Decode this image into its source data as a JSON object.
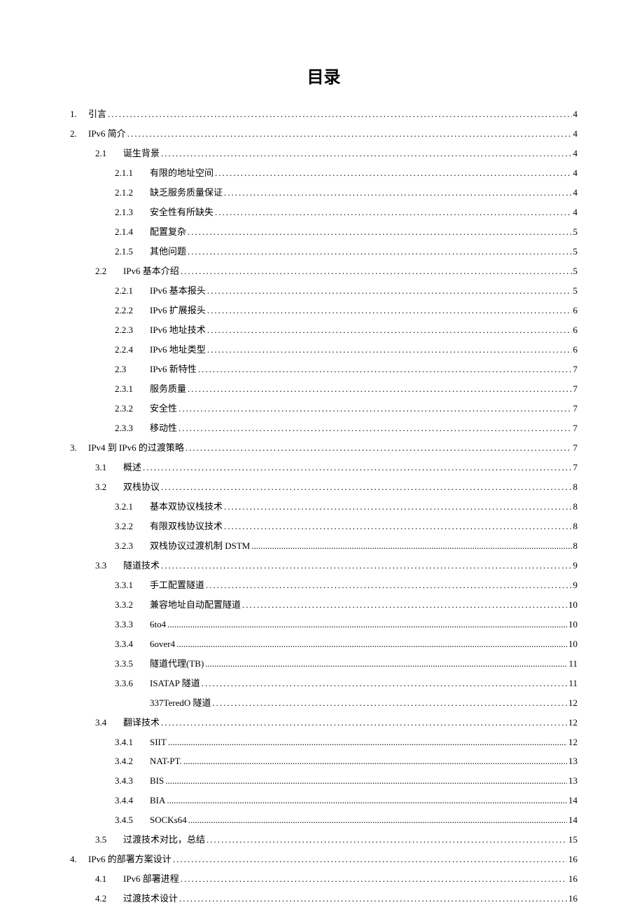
{
  "title": "目录",
  "entries": [
    {
      "level": 0,
      "num": "1.",
      "label": "引言",
      "page": "4",
      "dotStyle": "dots"
    },
    {
      "level": 0,
      "num": "2.",
      "label": "IPv6 简介",
      "page": "4",
      "dotStyle": "dots"
    },
    {
      "level": 1,
      "num": "2.1",
      "label": "诞生背景",
      "page": "4",
      "dotStyle": "dots"
    },
    {
      "level": 2,
      "num": "2.1.1",
      "label": "有限的地址空间",
      "page": "4",
      "dotStyle": "dots"
    },
    {
      "level": 2,
      "num": "2.1.2",
      "label": "缺乏服务质量保证",
      "page": "4",
      "dotStyle": "dots"
    },
    {
      "level": 2,
      "num": "2.1.3",
      "label": "安全性有所缺失",
      "page": "4",
      "dotStyle": "dots"
    },
    {
      "level": 2,
      "num": "2.1.4",
      "label": "配置复杂",
      "page": "5",
      "dotStyle": "dots"
    },
    {
      "level": 2,
      "num": "2.1.5",
      "label": "其他问题",
      "page": "5",
      "dotStyle": "dots"
    },
    {
      "level": 1,
      "num": "2.2",
      "label": "IPv6 基本介绍",
      "page": "5",
      "dotStyle": "dots"
    },
    {
      "level": 2,
      "num": "2.2.1",
      "label": "IPv6 基本报头",
      "page": "5",
      "dotStyle": "dots"
    },
    {
      "level": 2,
      "num": "2.2.2",
      "label": "IPv6 扩展报头",
      "page": "6",
      "dotStyle": "dots"
    },
    {
      "level": 2,
      "num": "2.2.3",
      "label": "IPv6 地址技术",
      "page": "6",
      "dotStyle": "dots"
    },
    {
      "level": 2,
      "num": "2.2.4",
      "label": "IPv6 地址类型",
      "page": "6",
      "dotStyle": "dots"
    },
    {
      "level": 2,
      "num": "2.3",
      "label": "IPv6 新特性",
      "page": "7",
      "dotStyle": "dots"
    },
    {
      "level": 2,
      "num": "2.3.1",
      "label": "服务质量",
      "page": "7",
      "dotStyle": "dots"
    },
    {
      "level": 2,
      "num": "2.3.2",
      "label": "安全性",
      "page": "7",
      "dotStyle": "dots"
    },
    {
      "level": 2,
      "num": "2.3.3",
      "label": "移动性",
      "page": "7",
      "dotStyle": "dots"
    },
    {
      "level": 0,
      "num": "3.",
      "label": "IPv4 到 IPv6 的过渡策略",
      "page": "7",
      "dotStyle": "dots"
    },
    {
      "level": 1,
      "num": "3.1",
      "label": "概述",
      "page": "7",
      "dotStyle": "dots"
    },
    {
      "level": 1,
      "num": "3.2",
      "label": "双栈协议",
      "page": "8",
      "dotStyle": "dots"
    },
    {
      "level": 2,
      "num": "3.2.1",
      "label": "基本双协议栈技术",
      "page": "8",
      "dotStyle": "dots"
    },
    {
      "level": 2,
      "num": "3.2.2",
      "label": "有限双栈协议技术",
      "page": "8",
      "dotStyle": "dots"
    },
    {
      "level": 2,
      "num": "3.2.3",
      "label": "双栈协议过渡机制 DSTM",
      "page": "8",
      "dotStyle": "dots-tight"
    },
    {
      "level": 1,
      "num": "3.3",
      "label": "隧道技术",
      "page": "9",
      "dotStyle": "dots"
    },
    {
      "level": 2,
      "num": "3.3.1",
      "label": "手工配置隧道",
      "page": "9",
      "dotStyle": "dots"
    },
    {
      "level": 2,
      "num": "3.3.2",
      "label": "兼容地址自动配置隧道",
      "page": "10",
      "dotStyle": "dots"
    },
    {
      "level": 2,
      "num": "3.3.3",
      "label": "6to4",
      "page": "10",
      "dotStyle": "dots-tight"
    },
    {
      "level": 2,
      "num": "3.3.4",
      "label": "6over4",
      "page": "10",
      "dotStyle": "dots-tight"
    },
    {
      "level": 2,
      "num": "3.3.5",
      "label": "隧道代理(TB)",
      "page": "11",
      "dotStyle": "dots-tight"
    },
    {
      "level": 2,
      "num": "3.3.6",
      "label": "ISATAP 隧道",
      "page": "11",
      "dotStyle": "dots"
    },
    {
      "level": 2,
      "num": "",
      "label": "337TeredO 隧道",
      "page": "12",
      "dotStyle": "dots"
    },
    {
      "level": 1,
      "num": "3.4",
      "label": "翻译技术",
      "page": "12",
      "dotStyle": "dots"
    },
    {
      "level": 2,
      "num": "3.4.1",
      "label": "SIIT",
      "page": "12",
      "dotStyle": "dots-tight"
    },
    {
      "level": 2,
      "num": "3.4.2",
      "label": "NAT-PT.",
      "page": "13",
      "dotStyle": "dots-tight"
    },
    {
      "level": 2,
      "num": "3.4.3",
      "label": "BIS",
      "page": "13",
      "dotStyle": "dots-tight"
    },
    {
      "level": 2,
      "num": "3.4.4",
      "label": "BIA",
      "page": "14",
      "dotStyle": "dots-tight"
    },
    {
      "level": 2,
      "num": "3.4.5",
      "label": "SOCKs64",
      "page": "14",
      "dotStyle": "dots-tight"
    },
    {
      "level": 1,
      "num": "3.5",
      "label": "过渡技术对比，总结",
      "page": "15",
      "dotStyle": "dots"
    },
    {
      "level": 0,
      "num": "4.",
      "label": "IPv6 的部署方案设计",
      "page": "16",
      "dotStyle": "dots"
    },
    {
      "level": 1,
      "num": "4.1",
      "label": "IPv6 部署进程",
      "page": "16",
      "dotStyle": "dots"
    },
    {
      "level": 1,
      "num": "4.2",
      "label": "过渡技术设计",
      "page": "16",
      "dotStyle": "dots"
    }
  ]
}
